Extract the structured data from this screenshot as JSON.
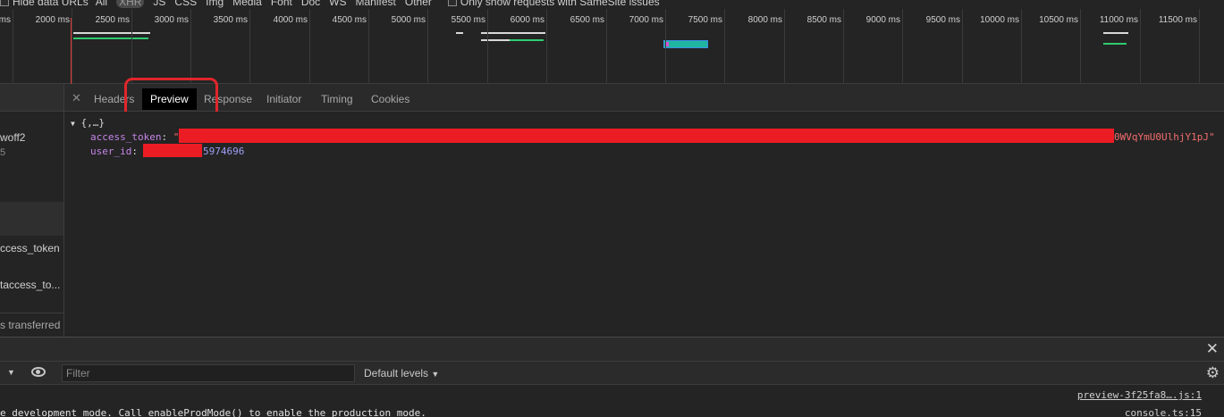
{
  "filter_bar": {
    "hide_data_urls": "Hide data URLs",
    "types": [
      "All",
      "XHR",
      "JS",
      "CSS",
      "Img",
      "Media",
      "Font",
      "Doc",
      "WS",
      "Manifest",
      "Other"
    ],
    "active_type": "XHR",
    "samesite": "Only show requests with SameSite issues"
  },
  "timeline": {
    "ticks": [
      "ms",
      "2000 ms",
      "2500 ms",
      "3000 ms",
      "3500 ms",
      "4000 ms",
      "4500 ms",
      "5000 ms",
      "5500 ms",
      "6000 ms",
      "6500 ms",
      "7000 ms",
      "7500 ms",
      "8000 ms",
      "8500 ms",
      "9000 ms",
      "9500 ms",
      "10000 ms",
      "10500 ms",
      "11000 ms",
      "11500 ms"
    ]
  },
  "request_list": {
    "items": [
      "woff2",
      "5",
      "ccess_token",
      "taccess_to..."
    ],
    "footer": "transferred"
  },
  "tabs": {
    "items": [
      "Headers",
      "Preview",
      "Response",
      "Initiator",
      "Timing",
      "Cookies"
    ],
    "active": "Preview"
  },
  "preview": {
    "root": "{,…}",
    "access_token_key": "access_token",
    "access_token_tail": "0WVqYmU0UlhjY1pJ",
    "user_id_key": "user_id",
    "user_id_tail": "5974696"
  },
  "console": {
    "filter_placeholder": "Filter",
    "levels": "Default levels",
    "source1": "preview-3f25fa8….js:1",
    "source2": "console.ts:15",
    "message": "e development mode. Call enableProdMode() to enable the production mode."
  },
  "colors": {
    "background": "#242424",
    "annotation": "#e0262b",
    "redaction": "#ec1c24",
    "string_value": "#f26d6d",
    "key": "#c585e8",
    "number_value": "#9f9ff5"
  }
}
